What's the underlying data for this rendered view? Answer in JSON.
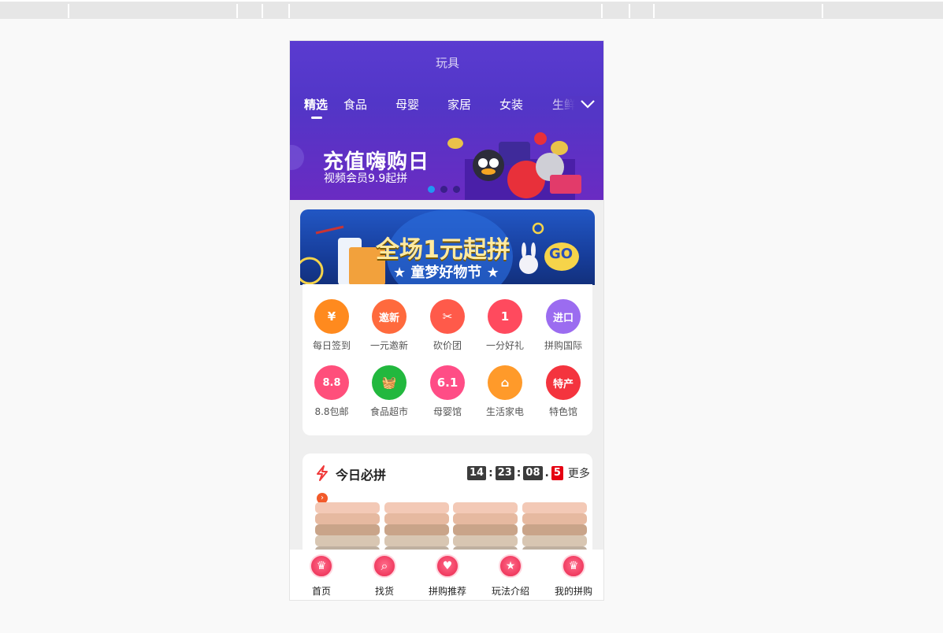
{
  "page": {
    "title": "玩具"
  },
  "tabs": [
    "精选",
    "食品",
    "母婴",
    "家居",
    "女装",
    "生鲜"
  ],
  "banner_top": {
    "headline": "充值嗨购日",
    "subline": "视频会员9.9起拼",
    "dots": 3,
    "active_dot": 0
  },
  "banner_promo": {
    "headline": "全场1元起拼",
    "subline": "★ 童梦好物节 ★",
    "badge": "GO"
  },
  "shortcuts": [
    {
      "label": "每日签到",
      "icon": "calendar-check-icon",
      "glyph": "¥",
      "color": "#ff8a1e"
    },
    {
      "label": "一元邀新",
      "icon": "invite-new-icon",
      "glyph": "邀新",
      "color": "#ff6a3d"
    },
    {
      "label": "砍价团",
      "icon": "price-cut-icon",
      "glyph": "✂",
      "color": "#ff5a4a"
    },
    {
      "label": "一分好礼",
      "icon": "lucky-wheel-icon",
      "glyph": "1",
      "color": "#ff4a5e"
    },
    {
      "label": "拼购国际",
      "icon": "plane-import-icon",
      "glyph": "进口",
      "color": "#9b6cf0"
    },
    {
      "label": "8.8包邮",
      "icon": "free-shipping-icon",
      "glyph": "8.8",
      "color": "#ff4f7b"
    },
    {
      "label": "食品超市",
      "icon": "basket-icon",
      "glyph": "🧺",
      "color": "#22b83e"
    },
    {
      "label": "母婴馆",
      "icon": "baby-icon",
      "glyph": "6.1",
      "color": "#ff4d86"
    },
    {
      "label": "生活家电",
      "icon": "rice-cooker-icon",
      "glyph": "⌂",
      "color": "#ff9a2a"
    },
    {
      "label": "特色馆",
      "icon": "china-map-icon",
      "glyph": "特产",
      "color": "#f4343e"
    }
  ],
  "deal": {
    "title": "今日必拼",
    "timer": {
      "h": "14",
      "m": "23",
      "s": "08",
      "ms": "5"
    },
    "more": "更多"
  },
  "tabbar": [
    {
      "label": "首页",
      "icon": "crown-home-icon",
      "glyph": "♛"
    },
    {
      "label": "找货",
      "icon": "search-icon",
      "glyph": "⌕"
    },
    {
      "label": "拼购推荐",
      "icon": "heart-icon",
      "glyph": "♥"
    },
    {
      "label": "玩法介绍",
      "icon": "star-icon",
      "glyph": "★"
    },
    {
      "label": "我的拼购",
      "icon": "crown-profile-icon",
      "glyph": "♛"
    }
  ],
  "colors": {
    "header_bg": "#5a3bd0",
    "accent": "#f03a5f",
    "timer_red": "#e50012"
  }
}
